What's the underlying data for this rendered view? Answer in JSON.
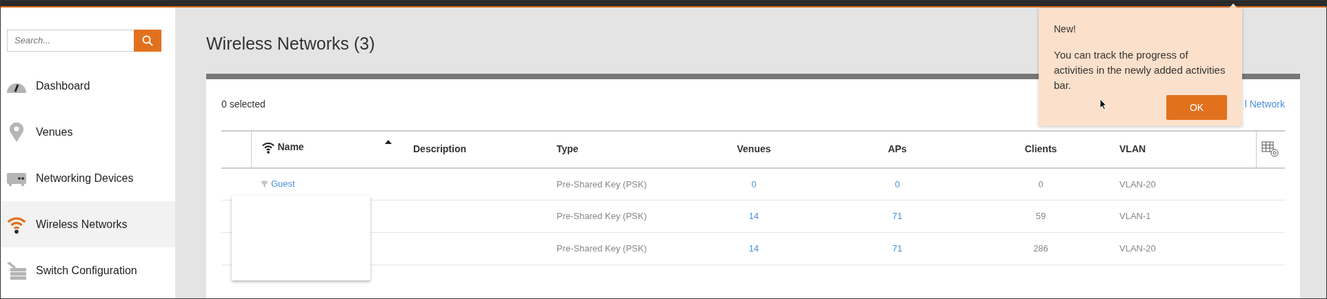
{
  "sidebar": {
    "search": {
      "placeholder": "Search..."
    },
    "items": [
      {
        "label": "Dashboard",
        "selected": false
      },
      {
        "label": "Venues",
        "selected": false
      },
      {
        "label": "Networking Devices",
        "selected": false
      },
      {
        "label": "Wireless Networks",
        "selected": true
      },
      {
        "label": "Switch Configuration",
        "selected": false
      }
    ]
  },
  "page_title": "Wireless Networks (3)",
  "selection_count": "0 selected",
  "add_link": "l Network",
  "table": {
    "columns": [
      {
        "label": "Name",
        "sorted": true
      },
      {
        "label": "Description",
        "sorted": false
      },
      {
        "label": "Type",
        "sorted": false
      },
      {
        "label": "Venues",
        "sorted": false
      },
      {
        "label": "APs",
        "sorted": false
      },
      {
        "label": "Clients",
        "sorted": false
      },
      {
        "label": "VLAN",
        "sorted": false
      }
    ],
    "rows": [
      {
        "name": "Guest",
        "type": "Pre-Shared Key (PSK)",
        "venues": "0",
        "aps": "0",
        "clients": "0",
        "vlan": "VLAN-20"
      },
      {
        "type": "Pre-Shared Key (PSK)",
        "venues": "14",
        "aps": "71",
        "clients": "59",
        "vlan": "VLAN-1"
      },
      {
        "type": "Pre-Shared Key (PSK)",
        "venues": "14",
        "aps": "71",
        "clients": "286",
        "vlan": "VLAN-20"
      }
    ]
  },
  "tooltip": {
    "title": "New!",
    "message": "You can track the progress of activities in the newly added activities bar.",
    "button": "OK"
  }
}
